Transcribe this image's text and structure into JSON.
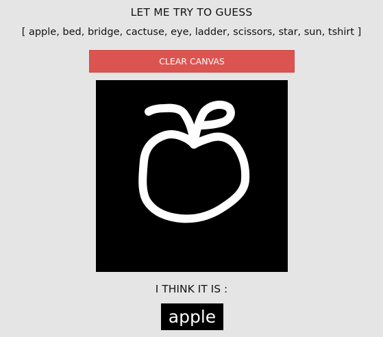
{
  "header": {
    "title": "LET ME TRY TO GUESS",
    "classes_text": "[ apple, bed, bridge, cactuse, eye, ladder, scissors, star, sun, tshirt ]"
  },
  "toolbar": {
    "clear_label": "CLEAR CANVAS",
    "clear_color": "#dc5450"
  },
  "canvas": {
    "background": "#000000",
    "stroke_color": "#ffffff"
  },
  "result": {
    "label": "I THINK IT IS :",
    "guess": "apple"
  }
}
